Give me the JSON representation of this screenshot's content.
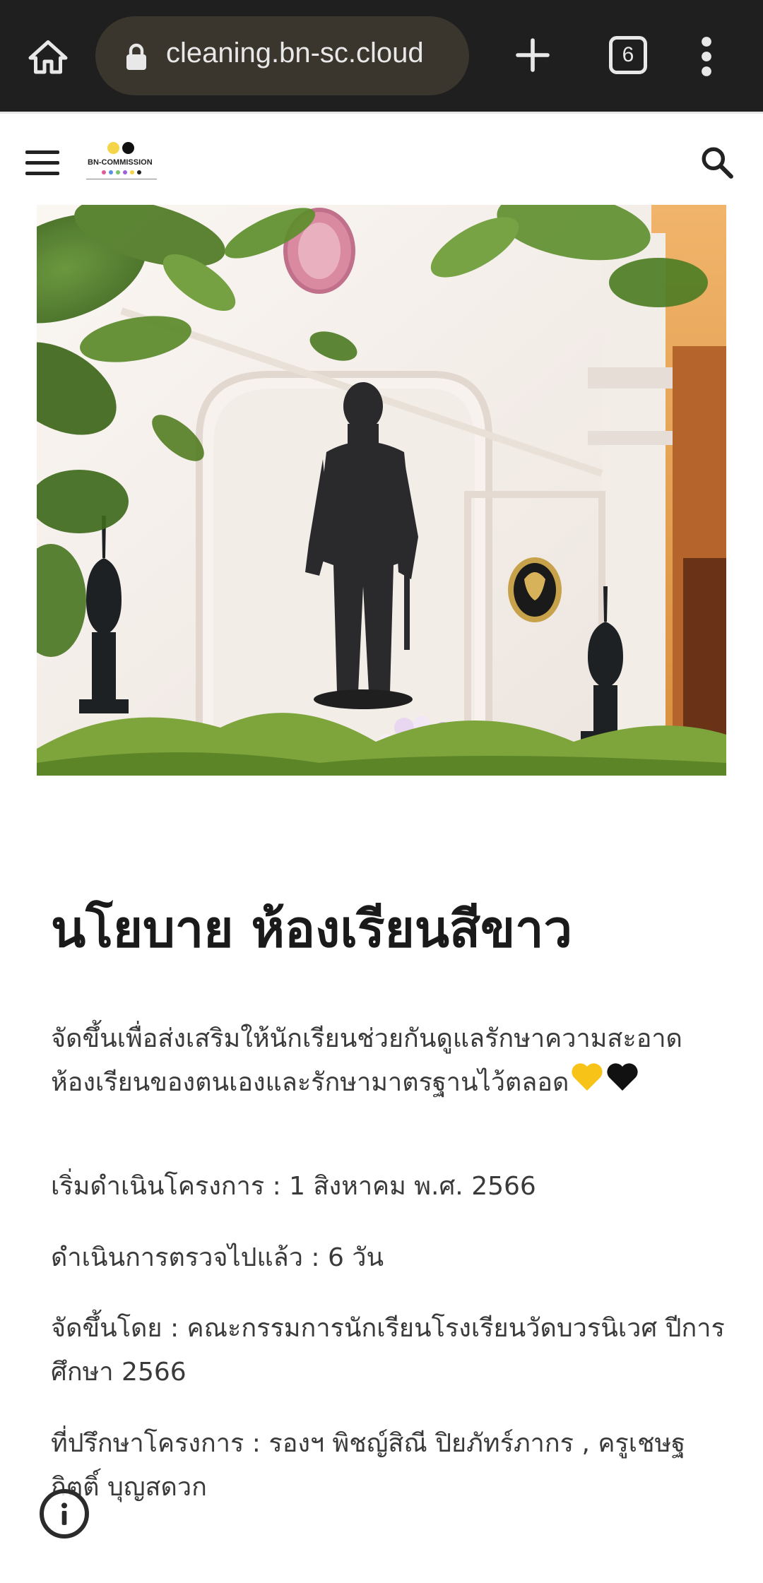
{
  "browser": {
    "url": "cleaning.bn-sc.cloud",
    "tab_count": "6"
  },
  "site": {
    "logo_text": "BN-COMMISSION",
    "logo_colors": [
      "#f5d547",
      "#111111",
      "#e05a9b",
      "#5b8ee6",
      "#7ac36b",
      "#9a62d6",
      "#222222"
    ]
  },
  "article": {
    "title": "นโยบาย ห้องเรียนสีขาว",
    "intro": "จัดขึ้นเพื่อส่งเสริมให้นักเรียนช่วยกันดูแลรักษาความสะอาดห้องเรียนของตนเองและรักษามาตรฐานไว้ตลอด",
    "start": "เริ่มดำเนินโครงการ  :  1  สิงหาคม  พ.ศ. 2566",
    "days": "ดำเนินการตรวจไปแล้ว  :  6  วัน",
    "organizer": "จัดขึ้นโดย : คณะกรรมการนักเรียนโรงเรียนวัดบวรนิเวศ ปีการศึกษา 2566",
    "advisors": "ที่ปรึกษาโครงการ : รองฯ พิชญ์สิณี ปิยภัทร์ภากร , ครูเชษฐกิตติ์ บุญสดวก"
  },
  "colors": {
    "browser_bar": "#1f1f1f",
    "url_pill": "#3a352d",
    "heart_yellow": "#f7c318",
    "heart_black": "#111111"
  }
}
